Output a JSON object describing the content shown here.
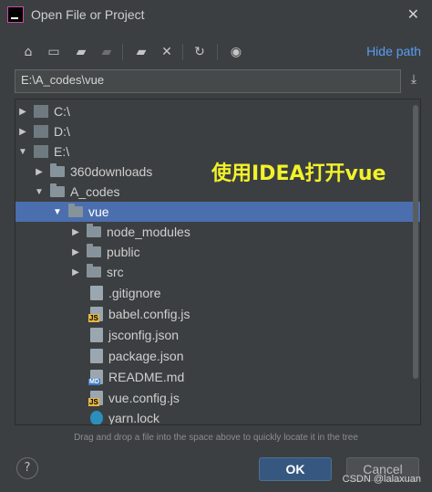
{
  "window": {
    "title": "Open File or Project",
    "close_label": "✕"
  },
  "toolbar": {
    "icons": [
      "home-icon",
      "desktop-icon",
      "project-folder-icon",
      "module-folder-icon",
      "new-folder-icon",
      "delete-icon",
      "refresh-icon",
      "show-hidden-icon"
    ],
    "hide_path_label": "Hide path"
  },
  "path": {
    "value": "E:\\A_codes\\vue"
  },
  "tree": {
    "rows": [
      {
        "label": "C:\\",
        "type": "drive",
        "expanded": false
      },
      {
        "label": "D:\\",
        "type": "drive",
        "expanded": false
      },
      {
        "label": "E:\\",
        "type": "drive",
        "expanded": true
      },
      {
        "label": "360downloads",
        "type": "folder",
        "expanded": false
      },
      {
        "label": "A_codes",
        "type": "folder",
        "expanded": true
      },
      {
        "label": "vue",
        "type": "folder",
        "expanded": true,
        "selected": true
      },
      {
        "label": "node_modules",
        "type": "folder",
        "expanded": false
      },
      {
        "label": "public",
        "type": "folder",
        "expanded": false
      },
      {
        "label": "src",
        "type": "folder",
        "expanded": false
      },
      {
        "label": ".gitignore",
        "type": "file"
      },
      {
        "label": "babel.config.js",
        "type": "js"
      },
      {
        "label": "jsconfig.json",
        "type": "file"
      },
      {
        "label": "package.json",
        "type": "file"
      },
      {
        "label": "README.md",
        "type": "md"
      },
      {
        "label": "vue.config.js",
        "type": "js"
      },
      {
        "label": "yarn.lock",
        "type": "yarn"
      }
    ]
  },
  "annotation": "使用IDEA打开vue",
  "hint": "Drag and drop a file into the space above to quickly locate it in the tree",
  "buttons": {
    "help": "?",
    "ok": "OK",
    "cancel": "Cancel"
  },
  "watermark": "CSDN @lalaxuan"
}
